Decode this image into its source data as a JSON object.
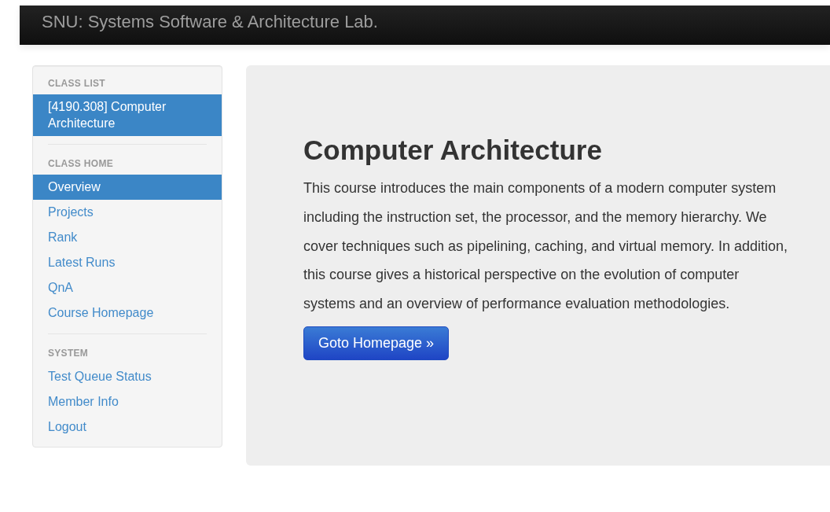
{
  "navbar": {
    "brand": "SNU: Systems Software & Architecture Lab."
  },
  "sidebar": {
    "sections": [
      {
        "heading": "CLASS LIST",
        "items": [
          {
            "label": "[4190.308] Computer Architecture",
            "selected": true
          }
        ]
      },
      {
        "heading": "CLASS HOME",
        "items": [
          {
            "label": "Overview",
            "selected": true
          },
          {
            "label": "Projects",
            "selected": false
          },
          {
            "label": "Rank",
            "selected": false
          },
          {
            "label": "Latest Runs",
            "selected": false
          },
          {
            "label": "QnA",
            "selected": false
          },
          {
            "label": "Course Homepage",
            "selected": false
          }
        ]
      },
      {
        "heading": "SYSTEM",
        "items": [
          {
            "label": "Test Queue Status",
            "selected": false
          },
          {
            "label": "Member Info",
            "selected": false
          },
          {
            "label": "Logout",
            "selected": false
          }
        ]
      }
    ]
  },
  "hero": {
    "title": "Computer Architecture",
    "description": "This course introduces the main components of a modern computer system including the instruction set, the processor, and the memory hierarchy. We cover techniques such as pipelining, caching, and virtual memory. In addition, this course gives a historical perspective on the evolution of computer systems and an overview of performance evaluation methodologies.",
    "button": "Goto Homepage »"
  }
}
